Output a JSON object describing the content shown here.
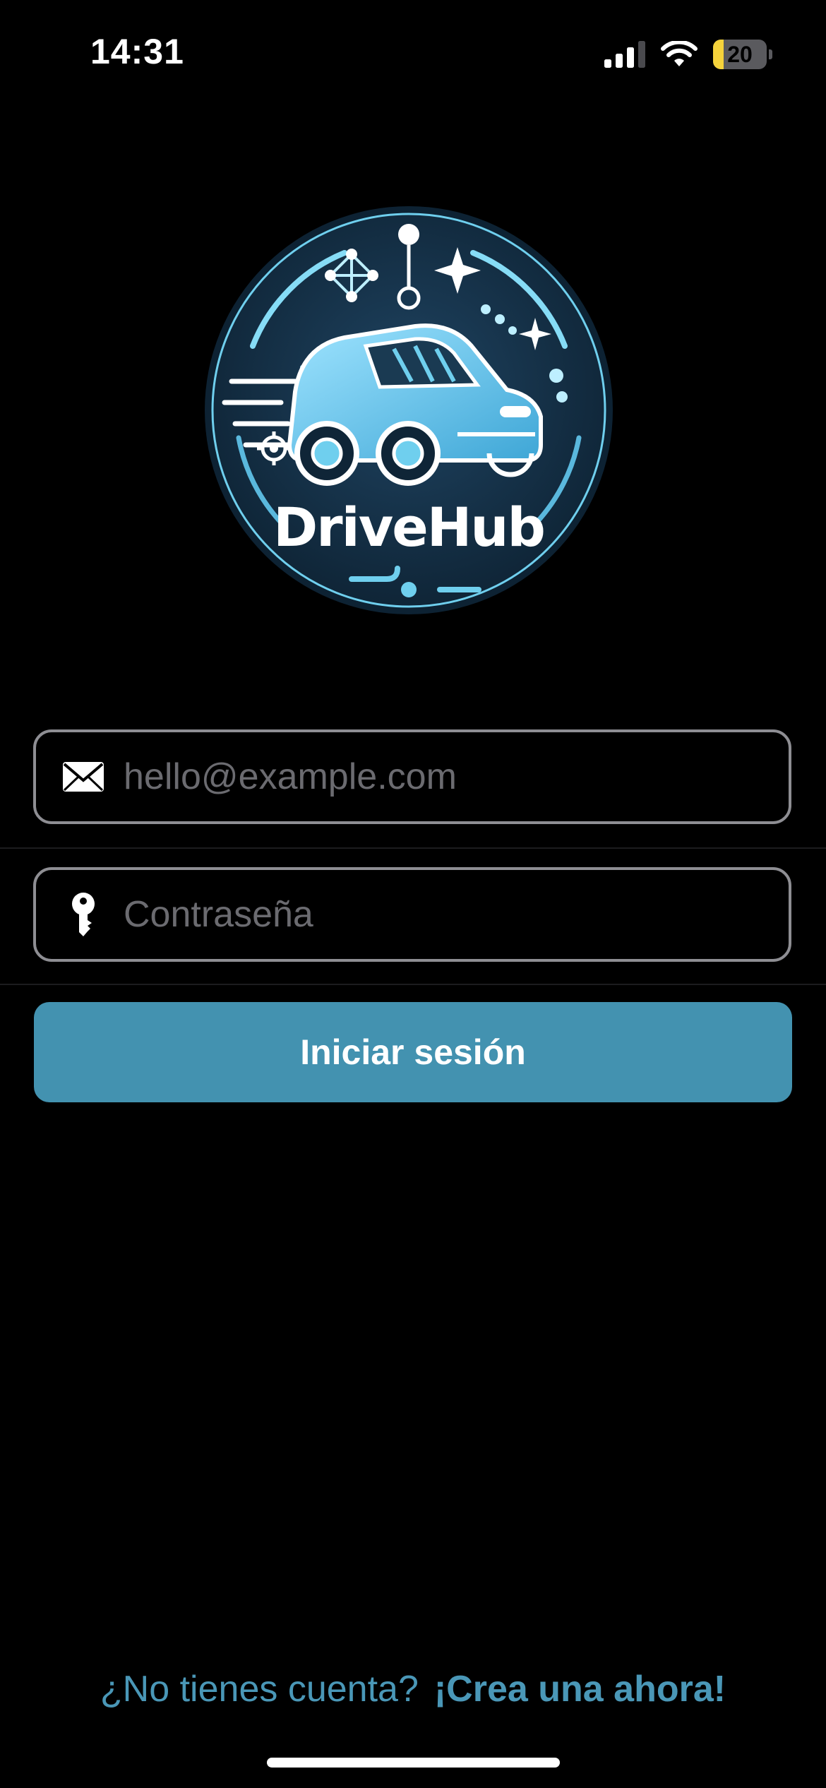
{
  "status_bar": {
    "time": "14:31",
    "battery_level": "20",
    "battery_fraction": 0.2,
    "icons": [
      "signal-icon",
      "wifi-icon",
      "battery-icon"
    ]
  },
  "logo": {
    "wordmark": "DriveHub",
    "icon": "car-logo-icon"
  },
  "login_form": {
    "email": {
      "icon": "envelope-icon",
      "placeholder": "hello@example.com",
      "value": ""
    },
    "password": {
      "icon": "key-icon",
      "placeholder": "Contraseña",
      "value": ""
    },
    "submit_label": "Iniciar sesión"
  },
  "footer": {
    "prompt": "¿No tienes cuenta?",
    "link_label": "¡Crea una ahora!"
  },
  "colors": {
    "background": "#000000",
    "accent": "#4392b0",
    "link": "#4a97b7",
    "field_border": "#8e8e93",
    "placeholder": "#6b6b70",
    "battery_fill": "#f5d33b"
  }
}
